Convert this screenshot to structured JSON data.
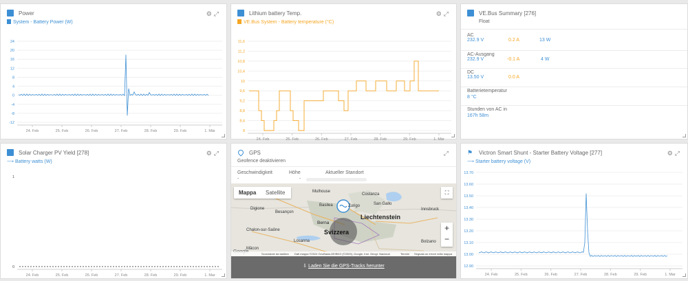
{
  "power": {
    "title": "Power",
    "legend": "System - Battery Power (W)",
    "yticks": [
      "24",
      "20",
      "16",
      "12",
      "8",
      "4",
      "0",
      "-4",
      "-8",
      "-12"
    ],
    "xticks": [
      "24. Feb",
      "25. Feb",
      "26. Feb",
      "27. Feb",
      "28. Feb",
      "29. Feb",
      "1. Mär"
    ]
  },
  "lithium": {
    "title": "Lithium battery Temp.",
    "legend": "VE.Bus System - Battery temperature (°C)",
    "yticks": [
      "11.6",
      "11.2",
      "10.8",
      "10.4",
      "10",
      "9.6",
      "9.2",
      "8.8",
      "8.4",
      "8"
    ],
    "yticks_display": [
      "11,6",
      "11,2",
      "10,8",
      "10,4",
      "10",
      "9,6",
      "9,2",
      "8,8",
      "8,4",
      "8"
    ],
    "xticks": [
      "24. Feb",
      "25. Feb",
      "26. Feb",
      "27. Feb",
      "28. Feb",
      "29. Feb",
      "1. Mär"
    ]
  },
  "vebus": {
    "title": "VE.Bus Summary [276]",
    "state": "Float",
    "ac_label": "AC",
    "ac_v": "232.9 V",
    "ac_a": "0.2 A",
    "ac_w": "13 W",
    "acout_label": "AC-Ausgang",
    "acout_v": "232.9 V",
    "acout_a": "-0.1 A",
    "acout_w": "4 W",
    "dc_label": "DC",
    "dc_v": "13.50 V",
    "dc_a": "0.0 A",
    "temp_label": "Batterietemperatur",
    "temp_val": "8 °C",
    "hours_label": "Stunden von AC in",
    "hours_val": "167h 58m"
  },
  "solar": {
    "title": "Solar Charger PV Yield [278]",
    "legend": "Battery watts (W)",
    "yticks": [
      "1",
      "0"
    ],
    "xticks": [
      "24. Feb",
      "25. Feb",
      "26. Feb",
      "27. Feb",
      "28. Feb",
      "29. Feb",
      "1. Mar"
    ]
  },
  "gps": {
    "title": "GPS",
    "geofence": "Geofence deaktivieren",
    "col_speed": "Geschwindigkeit",
    "col_height": "Höhe",
    "col_location": "Aktueller Standort",
    "speed_val": "-",
    "height_val": "-",
    "map_tab": "Mappa",
    "satellite_tab": "Satellite",
    "place_mulhouse": "Mulhouse",
    "place_basilea": "Basilea",
    "place_zurigo": "Zurigo",
    "place_costanza": "Costanza",
    "place_sangallo": "San Gallo",
    "place_liechtenstein": "Liechtenstein",
    "place_innsbruck": "Innsbruck",
    "place_dijon": "Digione",
    "place_besancon": "Besançon",
    "place_berna": "Berna",
    "place_chalon": "Chalon-sur-Saône",
    "place_svizzera": "Svizzera",
    "place_losanna": "Losanna",
    "place_bolzano": "Bolzano",
    "place_macon": "Mâcon",
    "footer_shortcuts": "Scorciatoie da tastiera",
    "footer_data": "Dati mappa ©2024 GeoBasis-DE/BKG (©2009), Google, Inst. Geogr. Nacional",
    "footer_terms": "Termini",
    "footer_report": "Segnala un errore nella mappa",
    "google": "Google",
    "download": "Laden Sie die GPS-Tracks herunter"
  },
  "shunt": {
    "title": "Victron Smart Shunt - Starter Battery Voltage [277]",
    "legend": "Starter battery voltage (V)",
    "yticks": [
      "13.70",
      "13.60",
      "13.50",
      "13.40",
      "13.30",
      "13.20",
      "13.10",
      "13.00",
      "12.90"
    ],
    "xticks": [
      "24. Feb",
      "25. Feb",
      "26. Feb",
      "27. Feb",
      "28. Feb",
      "29. Feb",
      "1. Mar"
    ]
  },
  "colors": {
    "blue": "#3d8fd4",
    "orange": "#f5a623"
  }
}
